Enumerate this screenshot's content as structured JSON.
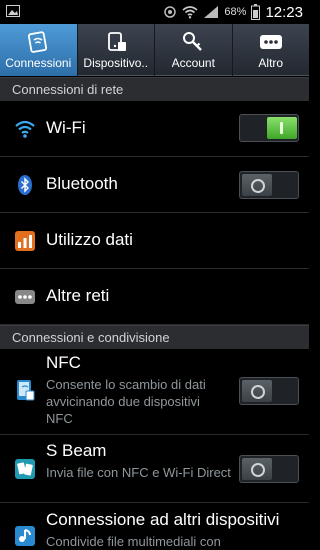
{
  "status_bar": {
    "battery_percent": "68%",
    "time": "12:23"
  },
  "tabs": [
    {
      "label": "Connessioni",
      "icon": "connections-icon",
      "active": true
    },
    {
      "label": "Dispositivo..",
      "icon": "device-icon",
      "active": false
    },
    {
      "label": "Account",
      "icon": "key-icon",
      "active": false
    },
    {
      "label": "Altro",
      "icon": "more-icon",
      "active": false
    }
  ],
  "sections": [
    {
      "title": "Connessioni di rete"
    },
    {
      "title": "Connessioni e condivisione"
    }
  ],
  "items": {
    "wifi": {
      "title": "Wi-Fi",
      "toggle": "on"
    },
    "bluetooth": {
      "title": "Bluetooth",
      "toggle": "off"
    },
    "data_usage": {
      "title": "Utilizzo dati"
    },
    "other_networks": {
      "title": "Altre reti"
    },
    "nfc": {
      "title": "NFC",
      "subtitle": "Consente lo scambio di dati avvicinando due dispositivi NFC",
      "toggle": "off"
    },
    "sbeam": {
      "title": "S Beam",
      "subtitle": "Invia file con NFC e Wi-Fi Direct",
      "toggle": "off"
    },
    "other_devices": {
      "title": "Connessione ad altri dispositivi",
      "subtitle": "Condivide file multimediali con"
    }
  },
  "colors": {
    "active_tab": "#3d86c6",
    "toggle_on": "#4cb832",
    "data_usage_icon": "#e07020"
  }
}
